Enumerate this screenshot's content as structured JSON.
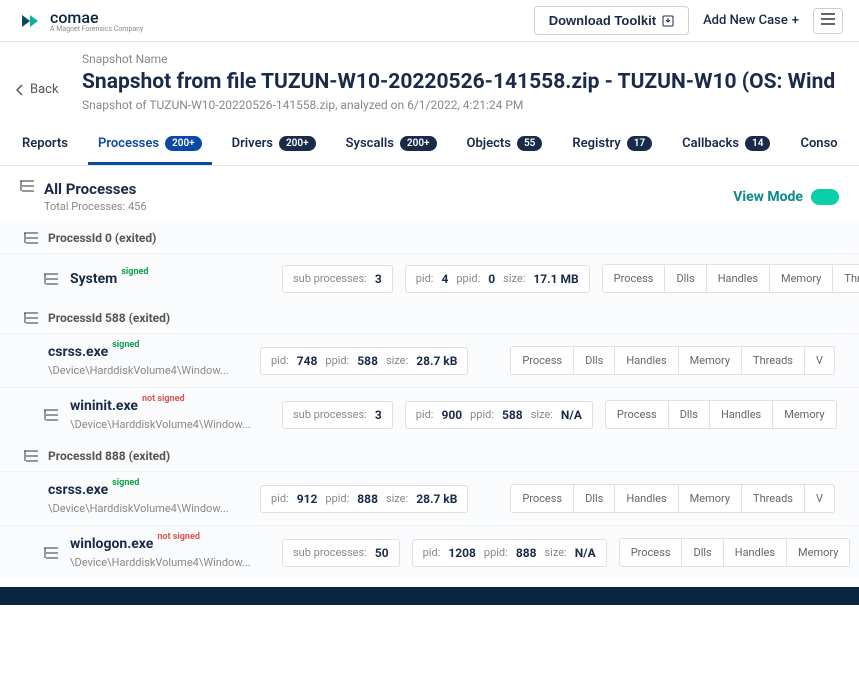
{
  "brand": {
    "name": "comae",
    "tagline": "A Magnet Forensics Company"
  },
  "topbar": {
    "download": "Download Toolkit",
    "addcase": "Add New Case"
  },
  "nav": {
    "back": "Back",
    "snapshot_label": "Snapshot Name",
    "title": "Snapshot from file TUZUN-W10-20220526-141558.zip - TUZUN-W10 (OS: Wind",
    "subtitle": "Snapshot of TUZUN-W10-20220526-141558.zip, analyzed on 6/1/2022, 4:21:24 PM"
  },
  "tabs": [
    {
      "label": "Reports",
      "count": ""
    },
    {
      "label": "Processes",
      "count": "200+"
    },
    {
      "label": "Drivers",
      "count": "200+"
    },
    {
      "label": "Syscalls",
      "count": "200+"
    },
    {
      "label": "Objects",
      "count": "55"
    },
    {
      "label": "Registry",
      "count": "17"
    },
    {
      "label": "Callbacks",
      "count": "14"
    },
    {
      "label": "Conso"
    }
  ],
  "section": {
    "title": "All Processes",
    "sub": "Total Processes: 456",
    "viewmode": "View Mode"
  },
  "labels": {
    "sub": "sub processes:",
    "pid": "pid:",
    "ppid": "ppid:",
    "size": "size:"
  },
  "actions": [
    "Process",
    "Dlls",
    "Handles",
    "Memory",
    "Threads",
    "V"
  ],
  "actions_short": [
    "Process",
    "Dlls",
    "Handles",
    "Memory"
  ],
  "groups": [
    {
      "head": "ProcessId 0  (exited)",
      "rows": [
        {
          "type": "parent",
          "name": "System",
          "sig": "signed",
          "sub": "3",
          "pid": "4",
          "ppid": "0",
          "size": "17.1 MB",
          "actions": "full"
        }
      ]
    },
    {
      "head": "ProcessId 588  (exited)",
      "rows": [
        {
          "type": "leaf",
          "name": "csrss.exe",
          "sig": "signed",
          "path": "\\Device\\HarddiskVolume4\\Window...",
          "pid": "748",
          "ppid": "588",
          "size": "28.7 kB",
          "actions": "full"
        },
        {
          "type": "parent",
          "name": "wininit.exe",
          "sig": "not signed",
          "path": "\\Device\\HarddiskVolume4\\Window...",
          "sub": "3",
          "pid": "900",
          "ppid": "588",
          "size": "N/A",
          "actions": "short"
        }
      ]
    },
    {
      "head": "ProcessId 888  (exited)",
      "rows": [
        {
          "type": "leaf",
          "name": "csrss.exe",
          "sig": "signed",
          "path": "\\Device\\HarddiskVolume4\\Window...",
          "pid": "912",
          "ppid": "888",
          "size": "28.7 kB",
          "actions": "full"
        },
        {
          "type": "parent",
          "name": "winlogon.exe",
          "sig": "not signed",
          "path": "\\Device\\HarddiskVolume4\\Window...",
          "sub": "50",
          "pid": "1208",
          "ppid": "888",
          "size": "N/A",
          "actions": "short"
        }
      ]
    }
  ]
}
